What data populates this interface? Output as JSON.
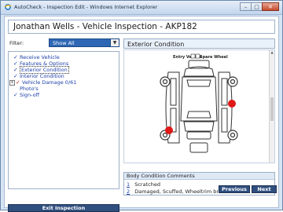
{
  "window": {
    "title": "AutoCheck - Inspection Edit - Windows Internet Explorer",
    "buttons": {
      "minimize": "–",
      "maximize": "□",
      "close": "✕"
    }
  },
  "header": {
    "title": "Jonathan Wells - Vehicle Inspection - AKP182"
  },
  "filter": {
    "label": "Filter:",
    "value": "Show All"
  },
  "tree": {
    "items": [
      {
        "label": "Receive Vehicle"
      },
      {
        "label": "Features & Options"
      },
      {
        "label": "Exterior Condition"
      },
      {
        "label": "Interior Condition"
      },
      {
        "label": "Vehicle Damage 0/61"
      },
      {
        "label": "Photo's"
      },
      {
        "label": "Sign-off"
      }
    ]
  },
  "buttons": {
    "exit": "Exit Inspection",
    "previous": "Previous",
    "next": "Next"
  },
  "pane": {
    "title": "Exterior Condition"
  },
  "diagram": {
    "entry_label": "Entry Vehicle",
    "spare_label": "Spare Wheel"
  },
  "comments": {
    "title": "Body Condition Comments",
    "rows": [
      {
        "num": "1",
        "text": "Scratched"
      },
      {
        "num": "2",
        "text": "Damaged, Scuffed, Wheeltrim broken"
      }
    ]
  },
  "colors": {
    "accent": "#2e67b4",
    "button": "#2f4f7e",
    "damage_marker": "#e01818"
  }
}
